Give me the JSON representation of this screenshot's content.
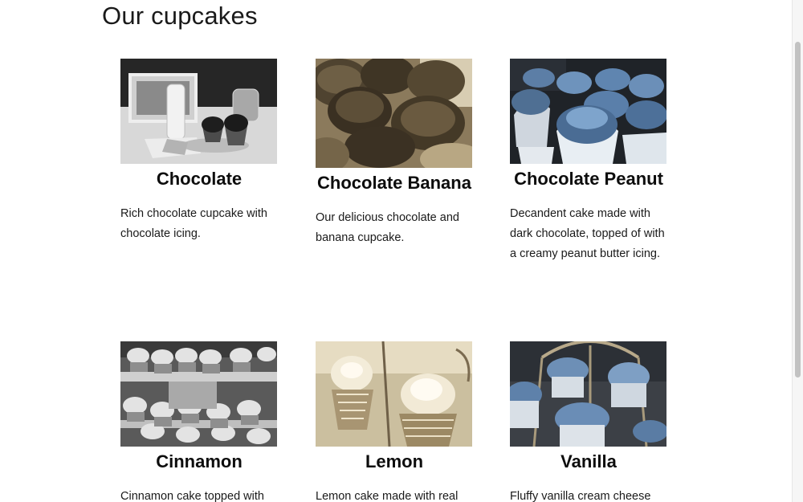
{
  "page": {
    "title": "Our cupcakes"
  },
  "cupcakes": [
    {
      "name": "Chocolate",
      "description": "Rich chocolate cupcake with chocolate icing.",
      "image_icon": "cupcake-photo-grayscale"
    },
    {
      "name": "Chocolate Banana",
      "description": "Our delicious chocolate and banana cupcake.",
      "image_icon": "cupcake-photo-sepia"
    },
    {
      "name": "Chocolate Peanut",
      "description": "Decandent cake made with dark chocolate, topped of with a creamy peanut butter icing.",
      "image_icon": "cupcake-photo-blue"
    },
    {
      "name": "Cinnamon",
      "description": "Cinnamon cake topped with",
      "image_icon": "cupcake-photo-grayscale"
    },
    {
      "name": "Lemon",
      "description": "Lemon cake made with real",
      "image_icon": "cupcake-photo-sepia"
    },
    {
      "name": "Vanilla",
      "description": "Fluffy vanilla cream cheese",
      "image_icon": "cupcake-photo-blue"
    }
  ]
}
